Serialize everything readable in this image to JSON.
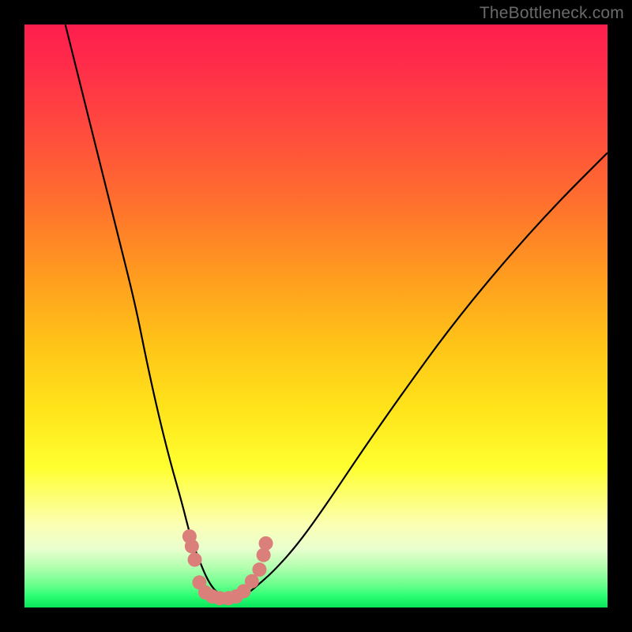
{
  "watermark": "TheBottleneck.com",
  "chart_data": {
    "type": "line",
    "title": "",
    "xlabel": "",
    "ylabel": "",
    "xlim": [
      0,
      100
    ],
    "ylim": [
      0,
      100
    ],
    "series": [
      {
        "name": "bottleneck-curve",
        "x": [
          7,
          10,
          13,
          16,
          19,
          21,
          23,
          25,
          27,
          28.5,
          30,
          31.5,
          33,
          34.5,
          36,
          38,
          40,
          43,
          47,
          52,
          58,
          65,
          73,
          82,
          91,
          100
        ],
        "values": [
          100,
          88,
          76,
          64,
          52,
          42,
          33,
          25,
          18,
          12,
          8,
          4.5,
          2.5,
          1.8,
          1.6,
          2.2,
          3.8,
          6.5,
          11,
          18,
          27,
          37,
          48,
          59,
          69,
          78
        ]
      }
    ],
    "markers": {
      "name": "highlight-points",
      "color": "#da7f79",
      "points": [
        {
          "x": 28.3,
          "y": 12.2
        },
        {
          "x": 28.7,
          "y": 10.5
        },
        {
          "x": 29.2,
          "y": 8.2
        },
        {
          "x": 30.0,
          "y": 4.3
        },
        {
          "x": 31.0,
          "y": 2.6
        },
        {
          "x": 32.2,
          "y": 1.9
        },
        {
          "x": 33.5,
          "y": 1.6
        },
        {
          "x": 35.0,
          "y": 1.6
        },
        {
          "x": 36.3,
          "y": 1.9
        },
        {
          "x": 37.6,
          "y": 2.8
        },
        {
          "x": 39.0,
          "y": 4.5
        },
        {
          "x": 40.3,
          "y": 6.5
        },
        {
          "x": 41.0,
          "y": 9.0
        },
        {
          "x": 41.4,
          "y": 11.0
        }
      ]
    },
    "background": {
      "type": "vertical-gradient",
      "meaning": "red=high bottleneck, green=low bottleneck"
    }
  }
}
